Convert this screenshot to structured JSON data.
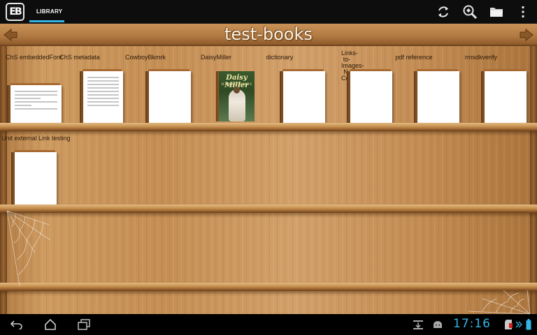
{
  "actionbar": {
    "logo_text": "EB",
    "tab_label": "LIBRARY",
    "icons": [
      "refresh-icon",
      "search-icon",
      "folder-icon",
      "overflow-menu-icon"
    ]
  },
  "shelf": {
    "title": "test-books",
    "books": [
      {
        "label": "ChS embeddedFont",
        "cover": "document"
      },
      {
        "label": "ChS metadata",
        "cover": "document"
      },
      {
        "label": "CowboyBkmrk",
        "cover": "blank"
      },
      {
        "label": "DaisyMiller",
        "cover": "daisy-miller"
      },
      {
        "label": "dictionary",
        "cover": "blank"
      },
      {
        "label": "Links-to-Images-N-Contents",
        "cover": "blank"
      },
      {
        "label": "pdf reference",
        "cover": "blank"
      },
      {
        "label": "rmsdkverify",
        "cover": "blank"
      },
      {
        "label": "Unit external Link testing",
        "cover": "blank"
      }
    ],
    "daisy_cover": {
      "title": "Daisy Miller",
      "author": "HENRY JAMES"
    }
  },
  "navbar": {
    "clock": "17:16",
    "icons": [
      "back-icon",
      "home-icon",
      "recent-apps-icon",
      "download-icon",
      "android-icon",
      "sd-card-icon",
      "battery-icon"
    ]
  },
  "colors": {
    "accent": "#33b5e5",
    "wood": "#c48e54",
    "bar": "#0d0d0d"
  }
}
